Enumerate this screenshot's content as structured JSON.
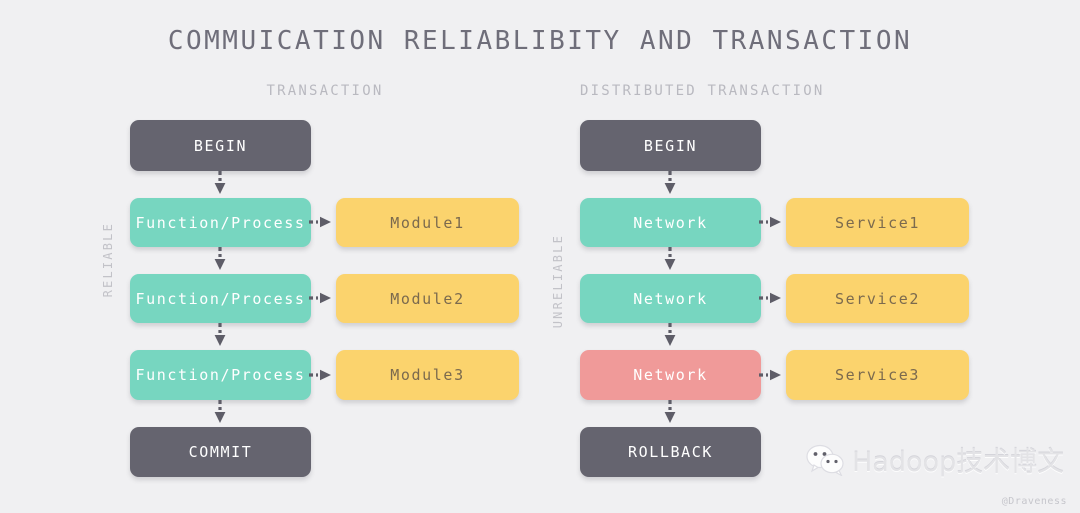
{
  "title": "COMMUICATION RELIABLIBITY AND TRANSACTION",
  "columns": {
    "left": {
      "subtitle": "TRANSACTION",
      "side_label": "RELIABLE",
      "flow": [
        {
          "label": "BEGIN",
          "style": "dark"
        },
        {
          "label": "Function/Process",
          "style": "teal"
        },
        {
          "label": "Function/Process",
          "style": "teal"
        },
        {
          "label": "Function/Process",
          "style": "teal"
        },
        {
          "label": "COMMIT",
          "style": "dark"
        }
      ],
      "targets": [
        {
          "label": "Module1",
          "style": "yellow"
        },
        {
          "label": "Module2",
          "style": "yellow"
        },
        {
          "label": "Module3",
          "style": "yellow"
        }
      ]
    },
    "right": {
      "subtitle": "DISTRIBUTED TRANSACTION",
      "side_label": "UNRELIABLE",
      "flow": [
        {
          "label": "BEGIN",
          "style": "dark"
        },
        {
          "label": "Network",
          "style": "teal"
        },
        {
          "label": "Network",
          "style": "teal"
        },
        {
          "label": "Network",
          "style": "red"
        },
        {
          "label": "ROLLBACK",
          "style": "dark"
        }
      ],
      "targets": [
        {
          "label": "Service1",
          "style": "yellow"
        },
        {
          "label": "Service2",
          "style": "yellow"
        },
        {
          "label": "Service3",
          "style": "yellow"
        }
      ]
    }
  },
  "watermark": {
    "text": "Hadoop技术博文",
    "credit": "@Draveness"
  },
  "colors": {
    "background": "#f0f0f2",
    "dark_box": "#65646f",
    "teal_box": "#77d6c0",
    "red_box": "#f09a99",
    "yellow_box": "#fbd36d",
    "title_text": "#6f6e7a",
    "subtitle_text": "#b9b9c0",
    "arrow": "#5e5d68"
  }
}
